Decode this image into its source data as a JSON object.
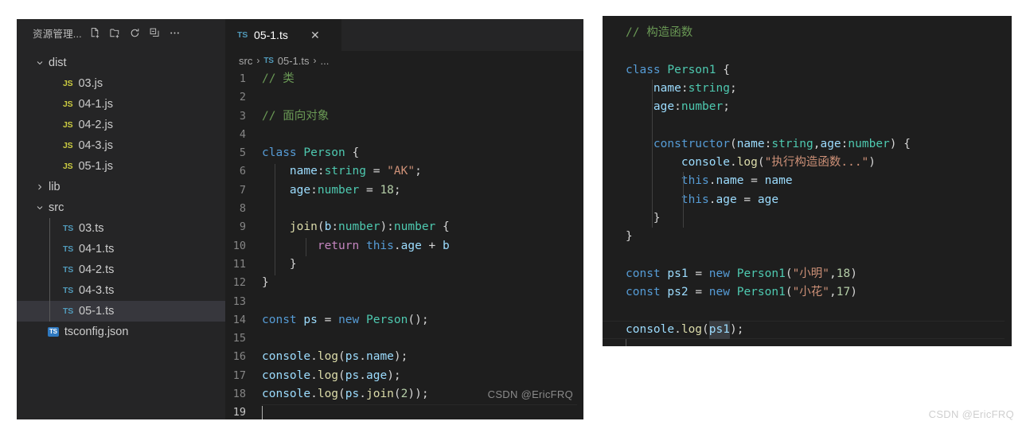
{
  "sidebar": {
    "title": "资源管理...",
    "actions": [
      {
        "name": "new-file-icon",
        "label": "New File"
      },
      {
        "name": "new-folder-icon",
        "label": "New Folder"
      },
      {
        "name": "refresh-icon",
        "label": "Refresh Explorer"
      },
      {
        "name": "collapse-all-icon",
        "label": "Collapse Folders in Explorer"
      },
      {
        "name": "more-actions-icon",
        "label": "Views and More Actions..."
      }
    ],
    "tree": [
      {
        "type": "folder",
        "label": "dist",
        "expanded": true,
        "depth": 0
      },
      {
        "type": "file",
        "label": "03.js",
        "icon": "JS",
        "iconKind": "js",
        "depth": 1
      },
      {
        "type": "file",
        "label": "04-1.js",
        "icon": "JS",
        "iconKind": "js",
        "depth": 1
      },
      {
        "type": "file",
        "label": "04-2.js",
        "icon": "JS",
        "iconKind": "js",
        "depth": 1
      },
      {
        "type": "file",
        "label": "04-3.js",
        "icon": "JS",
        "iconKind": "js",
        "depth": 1
      },
      {
        "type": "file",
        "label": "05-1.js",
        "icon": "JS",
        "iconKind": "js",
        "depth": 1
      },
      {
        "type": "folder",
        "label": "lib",
        "expanded": false,
        "depth": 0
      },
      {
        "type": "folder",
        "label": "src",
        "expanded": true,
        "depth": 0
      },
      {
        "type": "file",
        "label": "03.ts",
        "icon": "TS",
        "iconKind": "ts",
        "depth": 1
      },
      {
        "type": "file",
        "label": "04-1.ts",
        "icon": "TS",
        "iconKind": "ts",
        "depth": 1
      },
      {
        "type": "file",
        "label": "04-2.ts",
        "icon": "TS",
        "iconKind": "ts",
        "depth": 1
      },
      {
        "type": "file",
        "label": "04-3.ts",
        "icon": "TS",
        "iconKind": "ts",
        "depth": 1
      },
      {
        "type": "file",
        "label": "05-1.ts",
        "icon": "TS",
        "iconKind": "ts",
        "depth": 1,
        "selected": true
      },
      {
        "type": "file",
        "label": "tsconfig.json",
        "icon": "TS",
        "iconKind": "tsconfig",
        "depth": 0
      }
    ]
  },
  "editor": {
    "tab": {
      "icon": "TS",
      "label": "05-1.ts",
      "close": "✕",
      "active": true
    },
    "breadcrumb": {
      "folder": "src",
      "sep1": "›",
      "file_icon": "TS",
      "file": "05-1.ts",
      "sep2": "›",
      "ellipsis": "..."
    },
    "active_line": 19,
    "lines": [
      {
        "n": "1",
        "tokens": [
          {
            "t": "// 类",
            "c": "t-comment"
          }
        ]
      },
      {
        "n": "2",
        "tokens": []
      },
      {
        "n": "3",
        "tokens": [
          {
            "t": "// 面向对象",
            "c": "t-comment"
          }
        ]
      },
      {
        "n": "4",
        "tokens": []
      },
      {
        "n": "5",
        "tokens": [
          {
            "t": "class ",
            "c": "t-keyword"
          },
          {
            "t": "Person",
            "c": "t-class"
          },
          {
            "t": " {",
            "c": "t-punct"
          }
        ]
      },
      {
        "n": "6",
        "tokens": [
          {
            "t": "    ",
            "c": "t-plain"
          },
          {
            "t": "name",
            "c": "t-prop"
          },
          {
            "t": ":",
            "c": "t-punct"
          },
          {
            "t": "string",
            "c": "t-type"
          },
          {
            "t": " = ",
            "c": "t-punct"
          },
          {
            "t": "\"AK\"",
            "c": "t-string"
          },
          {
            "t": ";",
            "c": "t-punct"
          }
        ]
      },
      {
        "n": "7",
        "tokens": [
          {
            "t": "    ",
            "c": "t-plain"
          },
          {
            "t": "age",
            "c": "t-prop"
          },
          {
            "t": ":",
            "c": "t-punct"
          },
          {
            "t": "number",
            "c": "t-type"
          },
          {
            "t": " = ",
            "c": "t-punct"
          },
          {
            "t": "18",
            "c": "t-number"
          },
          {
            "t": ";",
            "c": "t-punct"
          }
        ]
      },
      {
        "n": "8",
        "tokens": []
      },
      {
        "n": "9",
        "tokens": [
          {
            "t": "    ",
            "c": "t-plain"
          },
          {
            "t": "join",
            "c": "t-yellow"
          },
          {
            "t": "(",
            "c": "t-punct"
          },
          {
            "t": "b",
            "c": "t-prop"
          },
          {
            "t": ":",
            "c": "t-punct"
          },
          {
            "t": "number",
            "c": "t-type"
          },
          {
            "t": ")",
            "c": "t-punct"
          },
          {
            "t": ":",
            "c": "t-punct"
          },
          {
            "t": "number",
            "c": "t-type"
          },
          {
            "t": " {",
            "c": "t-punct"
          }
        ]
      },
      {
        "n": "10",
        "tokens": [
          {
            "t": "        ",
            "c": "t-plain"
          },
          {
            "t": "return",
            "c": "t-ctrl"
          },
          {
            "t": " ",
            "c": "t-punct"
          },
          {
            "t": "this",
            "c": "t-keyword"
          },
          {
            "t": ".",
            "c": "t-punct"
          },
          {
            "t": "age",
            "c": "t-prop"
          },
          {
            "t": " + ",
            "c": "t-punct"
          },
          {
            "t": "b",
            "c": "t-prop"
          }
        ]
      },
      {
        "n": "11",
        "tokens": [
          {
            "t": "    }",
            "c": "t-punct"
          }
        ]
      },
      {
        "n": "12",
        "tokens": [
          {
            "t": "}",
            "c": "t-punct"
          }
        ]
      },
      {
        "n": "13",
        "tokens": []
      },
      {
        "n": "14",
        "tokens": [
          {
            "t": "const ",
            "c": "t-keyword"
          },
          {
            "t": "ps",
            "c": "t-prop"
          },
          {
            "t": " = ",
            "c": "t-punct"
          },
          {
            "t": "new ",
            "c": "t-keyword"
          },
          {
            "t": "Person",
            "c": "t-class"
          },
          {
            "t": "();",
            "c": "t-punct"
          }
        ]
      },
      {
        "n": "15",
        "tokens": []
      },
      {
        "n": "16",
        "tokens": [
          {
            "t": "console",
            "c": "t-prop"
          },
          {
            "t": ".",
            "c": "t-punct"
          },
          {
            "t": "log",
            "c": "t-yellow"
          },
          {
            "t": "(",
            "c": "t-punct"
          },
          {
            "t": "ps",
            "c": "t-prop"
          },
          {
            "t": ".",
            "c": "t-punct"
          },
          {
            "t": "name",
            "c": "t-prop"
          },
          {
            "t": ");",
            "c": "t-punct"
          }
        ]
      },
      {
        "n": "17",
        "tokens": [
          {
            "t": "console",
            "c": "t-prop"
          },
          {
            "t": ".",
            "c": "t-punct"
          },
          {
            "t": "log",
            "c": "t-yellow"
          },
          {
            "t": "(",
            "c": "t-punct"
          },
          {
            "t": "ps",
            "c": "t-prop"
          },
          {
            "t": ".",
            "c": "t-punct"
          },
          {
            "t": "age",
            "c": "t-prop"
          },
          {
            "t": ");",
            "c": "t-punct"
          }
        ]
      },
      {
        "n": "18",
        "tokens": [
          {
            "t": "console",
            "c": "t-prop"
          },
          {
            "t": ".",
            "c": "t-punct"
          },
          {
            "t": "log",
            "c": "t-yellow"
          },
          {
            "t": "(",
            "c": "t-punct"
          },
          {
            "t": "ps",
            "c": "t-prop"
          },
          {
            "t": ".",
            "c": "t-punct"
          },
          {
            "t": "join",
            "c": "t-yellow"
          },
          {
            "t": "(",
            "c": "t-punct"
          },
          {
            "t": "2",
            "c": "t-number"
          },
          {
            "t": "));",
            "c": "t-punct"
          }
        ]
      },
      {
        "n": "19",
        "tokens": []
      }
    ]
  },
  "right_panel": {
    "highlighted_token": "ps1",
    "lines": [
      {
        "tokens": [
          {
            "t": "// 构造函数",
            "c": "t-comment"
          }
        ]
      },
      {
        "tokens": []
      },
      {
        "tokens": [
          {
            "t": "class ",
            "c": "t-keyword"
          },
          {
            "t": "Person1",
            "c": "t-class"
          },
          {
            "t": " {",
            "c": "t-punct"
          }
        ]
      },
      {
        "tokens": [
          {
            "t": "    ",
            "c": "t-plain"
          },
          {
            "t": "name",
            "c": "t-prop"
          },
          {
            "t": ":",
            "c": "t-punct"
          },
          {
            "t": "string",
            "c": "t-type"
          },
          {
            "t": ";",
            "c": "t-punct"
          }
        ]
      },
      {
        "tokens": [
          {
            "t": "    ",
            "c": "t-plain"
          },
          {
            "t": "age",
            "c": "t-prop"
          },
          {
            "t": ":",
            "c": "t-punct"
          },
          {
            "t": "number",
            "c": "t-type"
          },
          {
            "t": ";",
            "c": "t-punct"
          }
        ]
      },
      {
        "tokens": []
      },
      {
        "tokens": [
          {
            "t": "    ",
            "c": "t-plain"
          },
          {
            "t": "constructor",
            "c": "t-keyword"
          },
          {
            "t": "(",
            "c": "t-punct"
          },
          {
            "t": "name",
            "c": "t-prop"
          },
          {
            "t": ":",
            "c": "t-punct"
          },
          {
            "t": "string",
            "c": "t-type"
          },
          {
            "t": ",",
            "c": "t-punct"
          },
          {
            "t": "age",
            "c": "t-prop"
          },
          {
            "t": ":",
            "c": "t-punct"
          },
          {
            "t": "number",
            "c": "t-type"
          },
          {
            "t": ") {",
            "c": "t-punct"
          }
        ]
      },
      {
        "tokens": [
          {
            "t": "        ",
            "c": "t-plain"
          },
          {
            "t": "console",
            "c": "t-prop"
          },
          {
            "t": ".",
            "c": "t-punct"
          },
          {
            "t": "log",
            "c": "t-yellow"
          },
          {
            "t": "(",
            "c": "t-punct"
          },
          {
            "t": "\"执行构造函数...\"",
            "c": "t-string"
          },
          {
            "t": ")",
            "c": "t-punct"
          }
        ]
      },
      {
        "tokens": [
          {
            "t": "        ",
            "c": "t-plain"
          },
          {
            "t": "this",
            "c": "t-keyword"
          },
          {
            "t": ".",
            "c": "t-punct"
          },
          {
            "t": "name",
            "c": "t-prop"
          },
          {
            "t": " = ",
            "c": "t-punct"
          },
          {
            "t": "name",
            "c": "t-prop"
          }
        ]
      },
      {
        "tokens": [
          {
            "t": "        ",
            "c": "t-plain"
          },
          {
            "t": "this",
            "c": "t-keyword"
          },
          {
            "t": ".",
            "c": "t-punct"
          },
          {
            "t": "age",
            "c": "t-prop"
          },
          {
            "t": " = ",
            "c": "t-punct"
          },
          {
            "t": "age",
            "c": "t-prop"
          }
        ]
      },
      {
        "tokens": [
          {
            "t": "    }",
            "c": "t-punct"
          }
        ]
      },
      {
        "tokens": [
          {
            "t": "}",
            "c": "t-punct"
          }
        ]
      },
      {
        "tokens": []
      },
      {
        "tokens": [
          {
            "t": "const ",
            "c": "t-keyword"
          },
          {
            "t": "ps1",
            "c": "t-prop"
          },
          {
            "t": " = ",
            "c": "t-punct"
          },
          {
            "t": "new ",
            "c": "t-keyword"
          },
          {
            "t": "Person1",
            "c": "t-class"
          },
          {
            "t": "(",
            "c": "t-punct"
          },
          {
            "t": "\"小明\"",
            "c": "t-string"
          },
          {
            "t": ",",
            "c": "t-punct"
          },
          {
            "t": "18",
            "c": "t-number"
          },
          {
            "t": ")",
            "c": "t-punct"
          }
        ]
      },
      {
        "tokens": [
          {
            "t": "const ",
            "c": "t-keyword"
          },
          {
            "t": "ps2",
            "c": "t-prop"
          },
          {
            "t": " = ",
            "c": "t-punct"
          },
          {
            "t": "new ",
            "c": "t-keyword"
          },
          {
            "t": "Person1",
            "c": "t-class"
          },
          {
            "t": "(",
            "c": "t-punct"
          },
          {
            "t": "\"小花\"",
            "c": "t-string"
          },
          {
            "t": ",",
            "c": "t-punct"
          },
          {
            "t": "17",
            "c": "t-number"
          },
          {
            "t": ")",
            "c": "t-punct"
          }
        ]
      },
      {
        "tokens": []
      },
      {
        "current": true,
        "tokens": [
          {
            "t": "console",
            "c": "t-prop"
          },
          {
            "t": ".",
            "c": "t-punct"
          },
          {
            "t": "log",
            "c": "t-yellow"
          },
          {
            "t": "(",
            "c": "t-punct"
          },
          {
            "t": "ps1",
            "c": "t-prop",
            "sel": true
          },
          {
            "t": ");",
            "c": "t-punct"
          }
        ]
      },
      {
        "tokens": [
          {
            "t": " ",
            "c": "t-plain"
          }
        ]
      }
    ]
  },
  "watermarks": {
    "inner": "CSDN @EricFRQ",
    "outer": "CSDN @EricFRQ"
  },
  "colors": {
    "editor_bg": "#1e1e1e",
    "sidebar_bg": "#252526",
    "selection_row": "#37373d",
    "comment": "#6a9955",
    "keyword": "#569cd6",
    "class": "#4ec9b0",
    "property": "#9cdcfe",
    "string": "#ce9178",
    "number": "#b5cea8",
    "function": "#dcdcaa",
    "control": "#c586c0",
    "js_icon": "#cbcb41",
    "ts_icon": "#519aba"
  }
}
